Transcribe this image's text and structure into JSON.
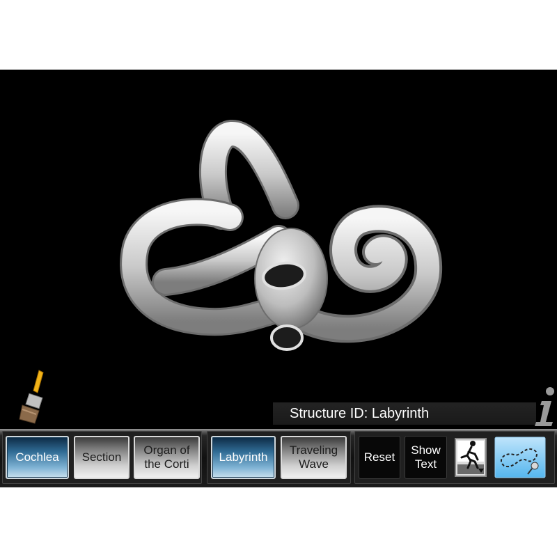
{
  "structure": {
    "label": "Structure ID: Labyrinth"
  },
  "toolbar": {
    "group1": [
      {
        "id": "cochlea",
        "label": "Cochlea",
        "style": "blue",
        "selected": false
      },
      {
        "id": "section",
        "label": "Section",
        "style": "silver",
        "selected": false
      },
      {
        "id": "organ-of-the-corti",
        "label": "Organ of\nthe Corti",
        "style": "silver",
        "selected": false
      }
    ],
    "group2": [
      {
        "id": "labyrinth",
        "label": "Labyrinth",
        "style": "blue",
        "selected": true
      },
      {
        "id": "traveling-wave",
        "label": "Traveling\nWave",
        "style": "silver",
        "selected": false
      }
    ],
    "group3": [
      {
        "id": "reset",
        "label": "Reset"
      },
      {
        "id": "show-text",
        "label": "Show\nText"
      }
    ],
    "icons": [
      "paint-brush-icon",
      "info-icon",
      "exit-runner-icon",
      "draw-path-icon"
    ]
  },
  "colors": {
    "background": "#000000",
    "accent_blue": "#4fa8e0",
    "model_gray": "#d8d8d8"
  }
}
